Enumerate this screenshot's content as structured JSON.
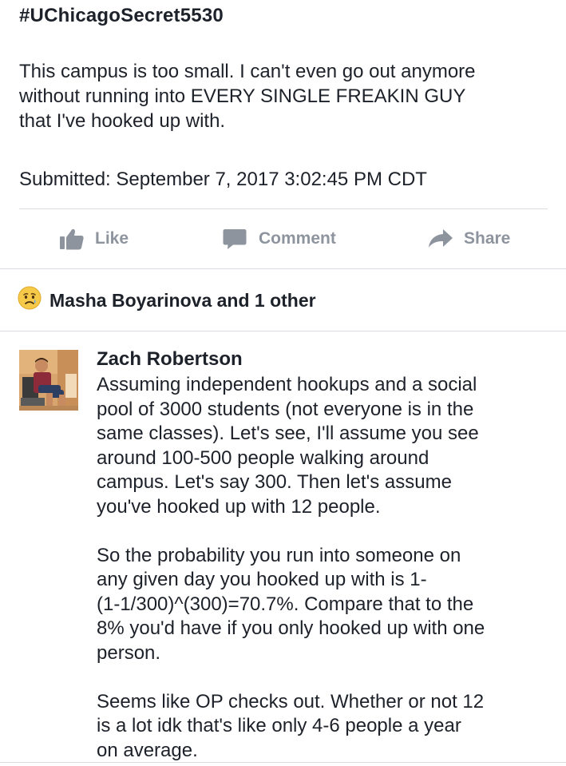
{
  "post": {
    "hashtag": "#UChicagoSecret5530",
    "body_lines": [
      "This campus is too small.  I can't even go out anymore",
      "without running into EVERY SINGLE FREAKIN GUY",
      "that I've hooked up with."
    ],
    "submitted": "Submitted:  September 7, 2017 3:02:45 PM CDT"
  },
  "actions": {
    "like": "Like",
    "comment": "Comment",
    "share": "Share"
  },
  "reactions": {
    "icon": "sad-face-emoji",
    "text": "Masha Boyarinova and 1 other"
  },
  "comment": {
    "author": "Zach Robertson",
    "paragraphs": [
      [
        "Assuming independent hookups and a social",
        "pool of 3000 students (not everyone is in the",
        "same classes). Let's see, I'll assume you see",
        "around 100-500 people walking around",
        "campus. Let's say 300. Then let's assume",
        "you've hooked up with 12 people."
      ],
      [
        "So the probability you run into someone on",
        "any given day you hooked up with is 1-",
        "(1-1/300)^(300)=70.7%. Compare that to the",
        "8% you'd have if you only hooked up with one",
        "person."
      ],
      [
        "Seems like OP checks out. Whether or not 12",
        "is a lot idk that's like only 4-6 people a year",
        "on average."
      ]
    ]
  },
  "colors": {
    "text": "#1d2129",
    "muted": "#8d949e",
    "divider": "#dadde1",
    "emoji": "#f7c948"
  }
}
